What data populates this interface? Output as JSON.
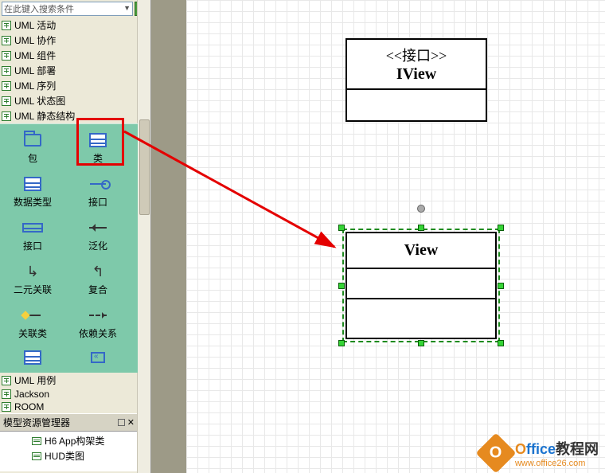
{
  "search": {
    "placeholder": "在此键入搜索条件"
  },
  "tree": [
    {
      "label": "UML 活动"
    },
    {
      "label": "UML 协作"
    },
    {
      "label": "UML 组件"
    },
    {
      "label": "UML 部署"
    },
    {
      "label": "UML 序列"
    },
    {
      "label": "UML 状态图"
    },
    {
      "label": "UML 静态结构"
    }
  ],
  "shapes": [
    {
      "label": "包",
      "icon": "folder"
    },
    {
      "label": "类",
      "icon": "class"
    },
    {
      "label": "数据类型",
      "icon": "class"
    },
    {
      "label": "接口",
      "icon": "lollipop"
    },
    {
      "label": "接口",
      "icon": "class2"
    },
    {
      "label": "泛化",
      "icon": "arrow-left"
    },
    {
      "label": "二元关联",
      "icon": "zz"
    },
    {
      "label": "复合",
      "icon": "zz2"
    },
    {
      "label": "关联类",
      "icon": "anchor"
    },
    {
      "label": "依赖关系",
      "icon": "dashed-arrow"
    },
    {
      "label": "",
      "icon": "class"
    },
    {
      "label": "",
      "icon": "pkg"
    }
  ],
  "tree2": [
    {
      "label": "UML 用例"
    },
    {
      "label": "Jackson"
    },
    {
      "label": "ROOM"
    }
  ],
  "model_panel_title": "模型资源管理器",
  "model_items": [
    {
      "label": "H6 App构架类"
    },
    {
      "label": "HUD类图"
    }
  ],
  "diagram": {
    "interface": {
      "stereo": "<<接口>>",
      "name": "IView"
    },
    "class": {
      "name": "View"
    }
  },
  "watermark": {
    "brand_prefix": "O",
    "brand_rest": "ffice",
    "brand_suffix": "教程网",
    "url": "www.office26.com"
  }
}
